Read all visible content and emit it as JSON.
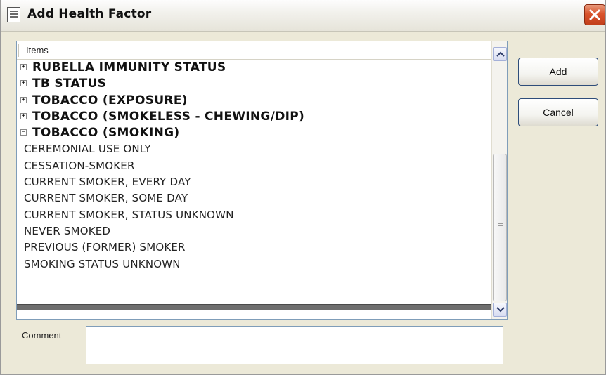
{
  "window": {
    "title": "Add Health Factor"
  },
  "list": {
    "header": "Items",
    "groups_collapsed": [
      "RUBELLA IMMUNITY STATUS",
      "TB STATUS",
      "TOBACCO (EXPOSURE)",
      "TOBACCO (SMOKELESS - CHEWING/DIP)"
    ],
    "expanded_group": "TOBACCO (SMOKING)",
    "children": [
      "CEREMONIAL USE ONLY",
      "CESSATION-SMOKER",
      "CURRENT SMOKER, EVERY DAY",
      "CURRENT SMOKER, SOME DAY",
      "CURRENT SMOKER, STATUS UNKNOWN",
      "NEVER SMOKED",
      "PREVIOUS (FORMER) SMOKER",
      "SMOKING STATUS UNKNOWN"
    ],
    "expander_collapsed": "+",
    "expander_expanded": "−"
  },
  "buttons": {
    "add": "Add",
    "cancel": "Cancel"
  },
  "comment": {
    "label": "Comment",
    "value": ""
  },
  "colors": {
    "close_button": "#d9542c",
    "list_border": "#7f9db9",
    "dialog_bg": "#ece9d8"
  }
}
